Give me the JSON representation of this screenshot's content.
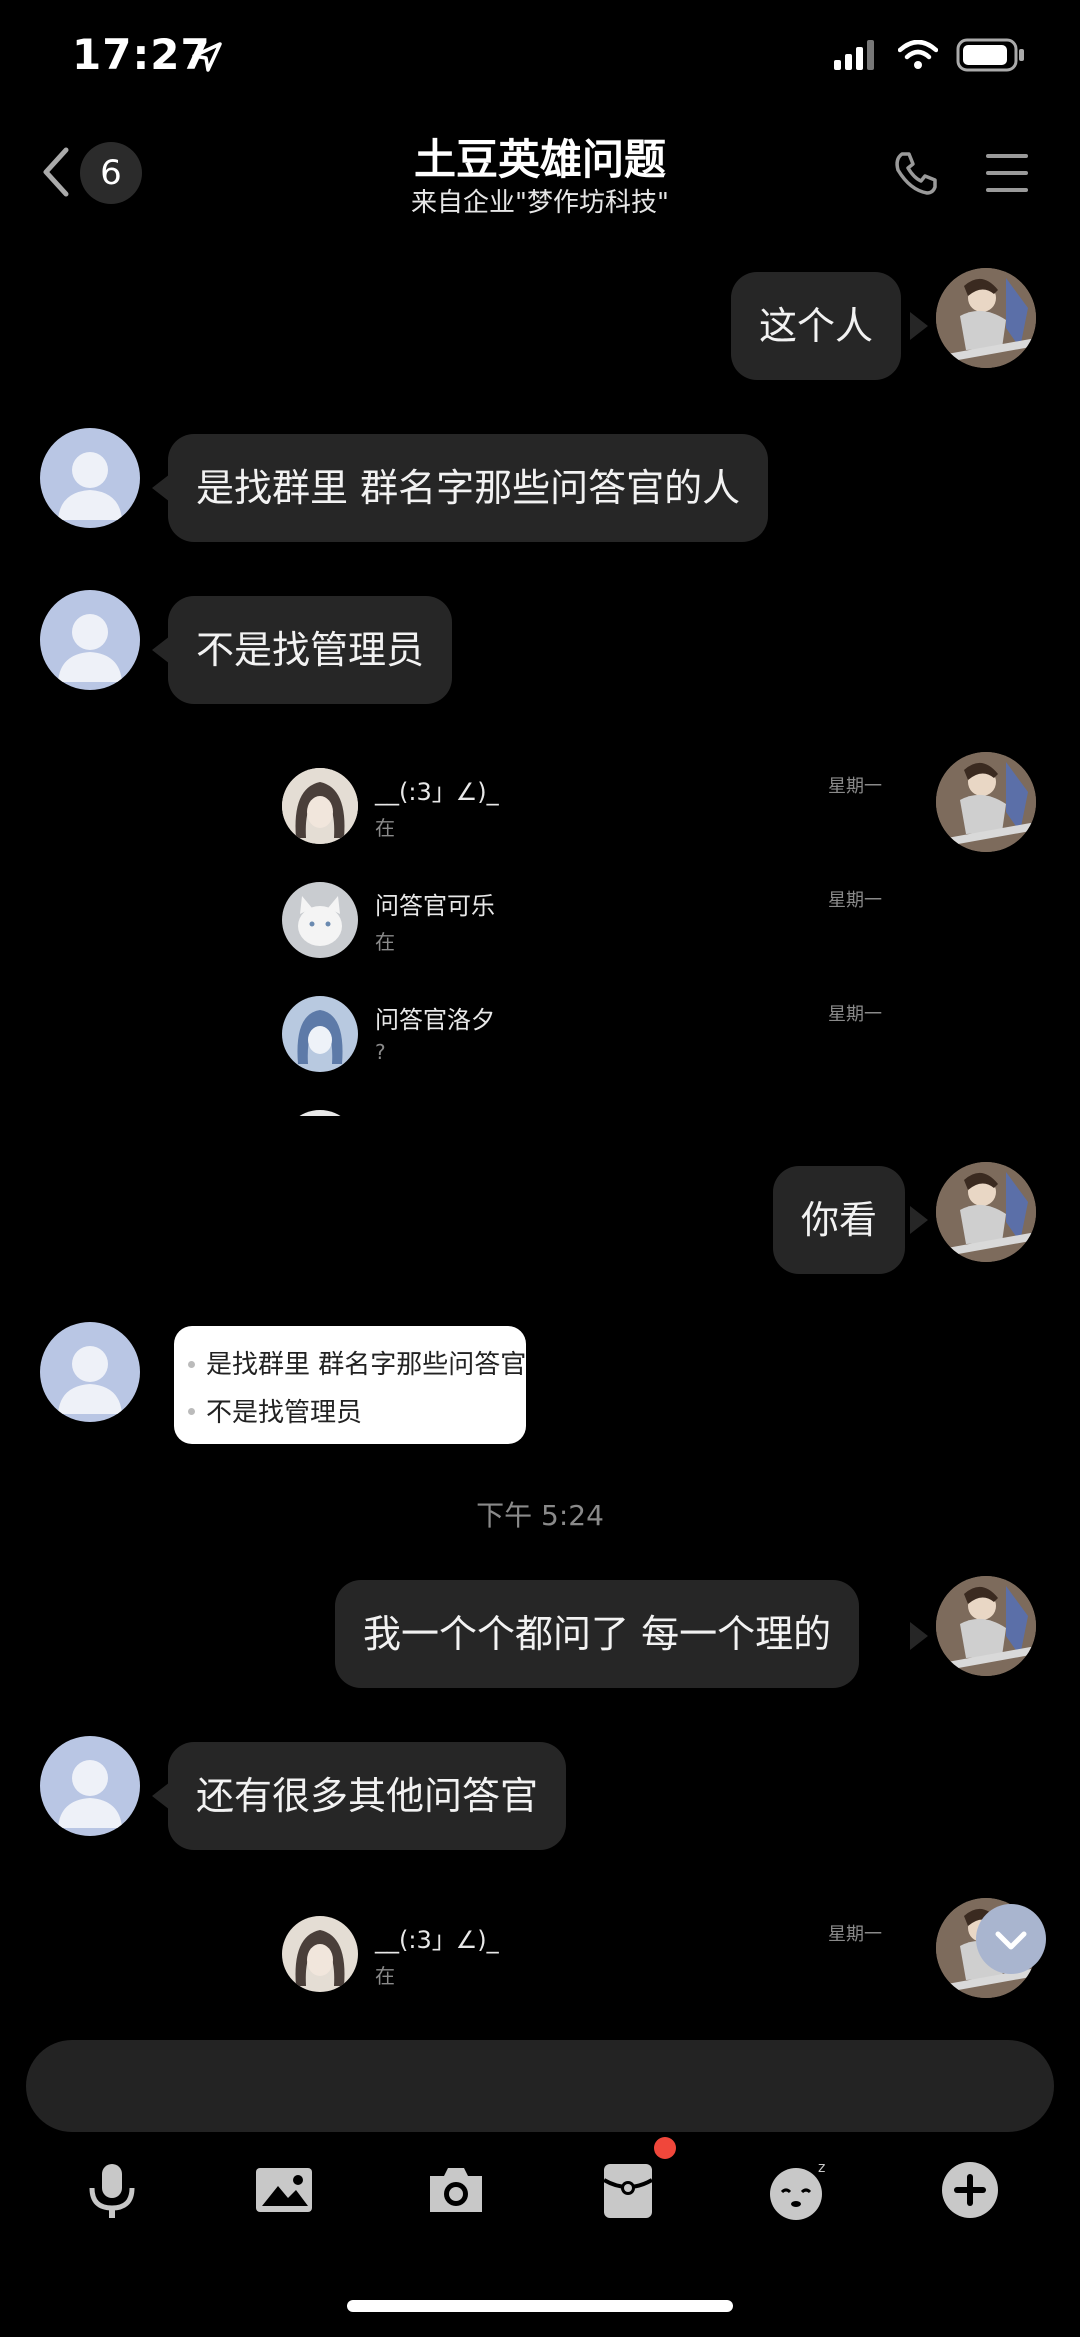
{
  "status_bar": {
    "time": "17:27"
  },
  "header": {
    "back_count": "6",
    "title": "土豆英雄问题",
    "subtitle": "来自企业\"梦作坊科技\""
  },
  "messages": [
    {
      "side": "me",
      "text": "这个人"
    },
    {
      "side": "peer",
      "text": "是找群里 群名字那些问答官的人"
    },
    {
      "side": "peer",
      "text": "不是找管理员"
    },
    {
      "side": "me",
      "text": "你看"
    },
    {
      "side": "me",
      "text": "我一个个都问了 每一个理的"
    },
    {
      "side": "peer",
      "text": "还有很多其他问答官"
    }
  ],
  "shared_screenshot_1": {
    "rows": [
      {
        "name": "__(:3」∠)_",
        "preview": "在",
        "time": "星期一"
      },
      {
        "name": "问答官可乐",
        "preview": "在",
        "time": "星期一"
      },
      {
        "name": "问答官洛夕",
        "preview": "?",
        "time": "星期一"
      }
    ]
  },
  "quote_card": {
    "lines": [
      "是找群里 群名字那些问答官",
      "不是找管理员"
    ]
  },
  "timestamp": "下午 5:24",
  "shared_screenshot_2": {
    "rows": [
      {
        "name": "__(:3」∠)_",
        "preview": "在",
        "time": "星期一"
      }
    ]
  },
  "toolbar": {
    "icons": [
      "microphone-icon",
      "image-icon",
      "camera-icon",
      "red-packet-icon",
      "sleepy-emoji-icon",
      "plus-icon"
    ],
    "red_packet_badge": true
  },
  "colors": {
    "background": "#000000",
    "bubble": "#262626",
    "accent_badge": "#f0473b"
  }
}
